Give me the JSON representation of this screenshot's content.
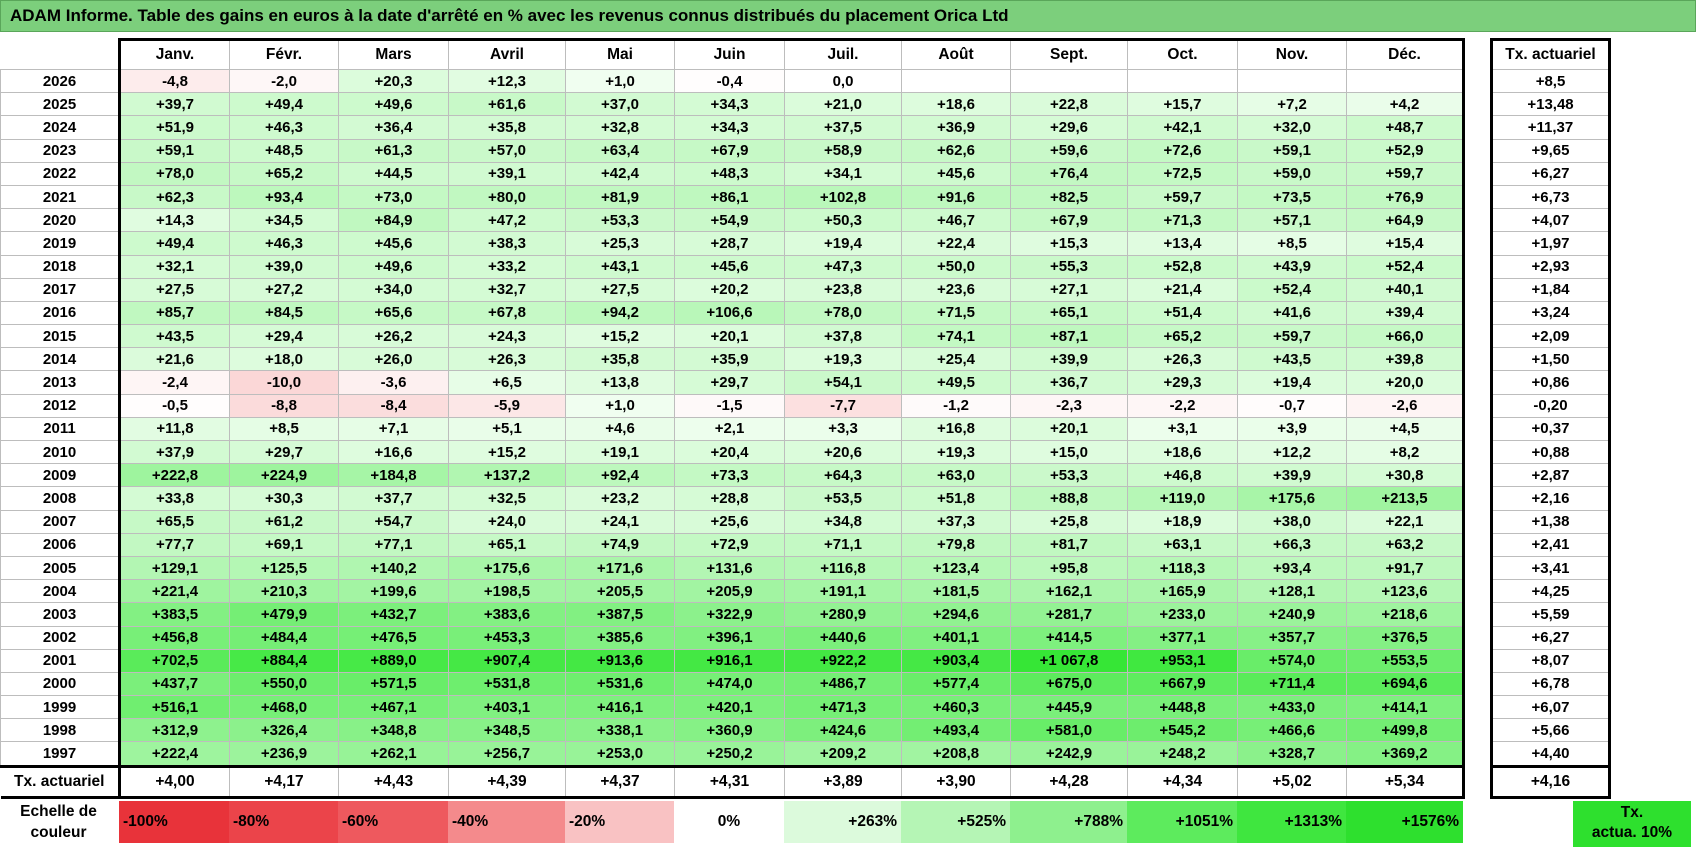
{
  "title": "ADAM Informe. Table des gains en euros à la date d'arrêté en % avec les revenus connus distribués du placement Orica Ltd",
  "months": [
    "Janv.",
    "Févr.",
    "Mars",
    "Avril",
    "Mai",
    "Juin",
    "Juil.",
    "Août",
    "Sept.",
    "Oct.",
    "Nov.",
    "Déc."
  ],
  "actuarial_header": "Tx. actuariel",
  "rows": [
    {
      "year": "2026",
      "values": [
        "-4,8",
        "-2,0",
        "+20,3",
        "+12,3",
        "+1,0",
        "-0,4",
        "0,0",
        "",
        "",
        "",
        "",
        ""
      ],
      "act": "+8,5"
    },
    {
      "year": "2025",
      "values": [
        "+39,7",
        "+49,4",
        "+49,6",
        "+61,6",
        "+37,0",
        "+34,3",
        "+21,0",
        "+18,6",
        "+22,8",
        "+15,7",
        "+7,2",
        "+4,2"
      ],
      "act": "+13,48"
    },
    {
      "year": "2024",
      "values": [
        "+51,9",
        "+46,3",
        "+36,4",
        "+35,8",
        "+32,8",
        "+34,3",
        "+37,5",
        "+36,9",
        "+29,6",
        "+42,1",
        "+32,0",
        "+48,7"
      ],
      "act": "+11,37"
    },
    {
      "year": "2023",
      "values": [
        "+59,1",
        "+48,5",
        "+61,3",
        "+57,0",
        "+63,4",
        "+67,9",
        "+58,9",
        "+62,6",
        "+59,6",
        "+72,6",
        "+59,1",
        "+52,9"
      ],
      "act": "+9,65"
    },
    {
      "year": "2022",
      "values": [
        "+78,0",
        "+65,2",
        "+44,5",
        "+39,1",
        "+42,4",
        "+48,3",
        "+34,1",
        "+45,6",
        "+76,4",
        "+72,5",
        "+59,0",
        "+59,7"
      ],
      "act": "+6,27"
    },
    {
      "year": "2021",
      "values": [
        "+62,3",
        "+93,4",
        "+73,0",
        "+80,0",
        "+81,9",
        "+86,1",
        "+102,8",
        "+91,6",
        "+82,5",
        "+59,7",
        "+73,5",
        "+76,9"
      ],
      "act": "+6,73"
    },
    {
      "year": "2020",
      "values": [
        "+14,3",
        "+34,5",
        "+84,9",
        "+47,2",
        "+53,3",
        "+54,9",
        "+50,3",
        "+46,7",
        "+67,9",
        "+71,3",
        "+57,1",
        "+64,9"
      ],
      "act": "+4,07"
    },
    {
      "year": "2019",
      "values": [
        "+49,4",
        "+46,3",
        "+45,6",
        "+38,3",
        "+25,3",
        "+28,7",
        "+19,4",
        "+22,4",
        "+15,3",
        "+13,4",
        "+8,5",
        "+15,4"
      ],
      "act": "+1,97"
    },
    {
      "year": "2018",
      "values": [
        "+32,1",
        "+39,0",
        "+49,6",
        "+33,2",
        "+43,1",
        "+45,6",
        "+47,3",
        "+50,0",
        "+55,3",
        "+52,8",
        "+43,9",
        "+52,4"
      ],
      "act": "+2,93"
    },
    {
      "year": "2017",
      "values": [
        "+27,5",
        "+27,2",
        "+34,0",
        "+32,7",
        "+27,5",
        "+20,2",
        "+23,8",
        "+23,6",
        "+27,1",
        "+21,4",
        "+52,4",
        "+40,1"
      ],
      "act": "+1,84"
    },
    {
      "year": "2016",
      "values": [
        "+85,7",
        "+84,5",
        "+65,6",
        "+67,8",
        "+94,2",
        "+106,6",
        "+78,0",
        "+71,5",
        "+65,1",
        "+51,4",
        "+41,6",
        "+39,4"
      ],
      "act": "+3,24"
    },
    {
      "year": "2015",
      "values": [
        "+43,5",
        "+29,4",
        "+26,2",
        "+24,3",
        "+15,2",
        "+20,1",
        "+37,8",
        "+74,1",
        "+87,1",
        "+65,2",
        "+59,7",
        "+66,0"
      ],
      "act": "+2,09"
    },
    {
      "year": "2014",
      "values": [
        "+21,6",
        "+18,0",
        "+26,0",
        "+26,3",
        "+35,8",
        "+35,9",
        "+19,3",
        "+25,4",
        "+39,9",
        "+26,3",
        "+43,5",
        "+39,8"
      ],
      "act": "+1,50"
    },
    {
      "year": "2013",
      "values": [
        "-2,4",
        "-10,0",
        "-3,6",
        "+6,5",
        "+13,8",
        "+29,7",
        "+54,1",
        "+49,5",
        "+36,7",
        "+29,3",
        "+19,4",
        "+20,0"
      ],
      "act": "+0,86"
    },
    {
      "year": "2012",
      "values": [
        "-0,5",
        "-8,8",
        "-8,4",
        "-5,9",
        "+1,0",
        "-1,5",
        "-7,7",
        "-1,2",
        "-2,3",
        "-2,2",
        "-0,7",
        "-2,6"
      ],
      "act": "-0,20"
    },
    {
      "year": "2011",
      "values": [
        "+11,8",
        "+8,5",
        "+7,1",
        "+5,1",
        "+4,6",
        "+2,1",
        "+3,3",
        "+16,8",
        "+20,1",
        "+3,1",
        "+3,9",
        "+4,5"
      ],
      "act": "+0,37"
    },
    {
      "year": "2010",
      "values": [
        "+37,9",
        "+29,7",
        "+16,6",
        "+15,2",
        "+19,1",
        "+20,4",
        "+20,6",
        "+19,3",
        "+15,0",
        "+18,6",
        "+12,2",
        "+8,2"
      ],
      "act": "+0,88"
    },
    {
      "year": "2009",
      "values": [
        "+222,8",
        "+224,9",
        "+184,8",
        "+137,2",
        "+92,4",
        "+73,3",
        "+64,3",
        "+63,0",
        "+53,3",
        "+46,8",
        "+39,9",
        "+30,8"
      ],
      "act": "+2,87"
    },
    {
      "year": "2008",
      "values": [
        "+33,8",
        "+30,3",
        "+37,7",
        "+32,5",
        "+23,2",
        "+28,8",
        "+53,5",
        "+51,8",
        "+88,8",
        "+119,0",
        "+175,6",
        "+213,5"
      ],
      "act": "+2,16"
    },
    {
      "year": "2007",
      "values": [
        "+65,5",
        "+61,2",
        "+54,7",
        "+24,0",
        "+24,1",
        "+25,6",
        "+34,8",
        "+37,3",
        "+25,8",
        "+18,9",
        "+38,0",
        "+22,1"
      ],
      "act": "+1,38"
    },
    {
      "year": "2006",
      "values": [
        "+77,7",
        "+69,1",
        "+77,1",
        "+65,1",
        "+74,9",
        "+72,9",
        "+71,1",
        "+79,8",
        "+81,7",
        "+63,1",
        "+66,3",
        "+63,2"
      ],
      "act": "+2,41"
    },
    {
      "year": "2005",
      "values": [
        "+129,1",
        "+125,5",
        "+140,2",
        "+175,6",
        "+171,6",
        "+131,6",
        "+116,8",
        "+123,4",
        "+95,8",
        "+118,3",
        "+93,4",
        "+91,7"
      ],
      "act": "+3,41"
    },
    {
      "year": "2004",
      "values": [
        "+221,4",
        "+210,3",
        "+199,6",
        "+198,5",
        "+205,5",
        "+205,9",
        "+191,1",
        "+181,5",
        "+162,1",
        "+165,9",
        "+128,1",
        "+123,6"
      ],
      "act": "+4,25"
    },
    {
      "year": "2003",
      "values": [
        "+383,5",
        "+479,9",
        "+432,7",
        "+383,6",
        "+387,5",
        "+322,9",
        "+280,9",
        "+294,6",
        "+281,7",
        "+233,0",
        "+240,9",
        "+218,6"
      ],
      "act": "+5,59"
    },
    {
      "year": "2002",
      "values": [
        "+456,8",
        "+484,4",
        "+476,5",
        "+453,3",
        "+385,6",
        "+396,1",
        "+440,6",
        "+401,1",
        "+414,5",
        "+377,1",
        "+357,7",
        "+376,5"
      ],
      "act": "+6,27"
    },
    {
      "year": "2001",
      "values": [
        "+702,5",
        "+884,4",
        "+889,0",
        "+907,4",
        "+913,6",
        "+916,1",
        "+922,2",
        "+903,4",
        "+1 067,8",
        "+953,1",
        "+574,0",
        "+553,5"
      ],
      "act": "+8,07"
    },
    {
      "year": "2000",
      "values": [
        "+437,7",
        "+550,0",
        "+571,5",
        "+531,8",
        "+531,6",
        "+474,0",
        "+486,7",
        "+577,4",
        "+675,0",
        "+667,9",
        "+711,4",
        "+694,6"
      ],
      "act": "+6,78"
    },
    {
      "year": "1999",
      "values": [
        "+516,1",
        "+468,0",
        "+467,1",
        "+403,1",
        "+416,1",
        "+420,1",
        "+471,3",
        "+460,3",
        "+445,9",
        "+448,8",
        "+433,0",
        "+414,1"
      ],
      "act": "+6,07"
    },
    {
      "year": "1998",
      "values": [
        "+312,9",
        "+326,4",
        "+348,8",
        "+348,5",
        "+338,1",
        "+360,9",
        "+424,6",
        "+493,4",
        "+581,0",
        "+545,2",
        "+466,6",
        "+499,8"
      ],
      "act": "+5,66"
    },
    {
      "year": "1997",
      "values": [
        "+222,4",
        "+236,9",
        "+262,1",
        "+256,7",
        "+253,0",
        "+250,2",
        "+209,2",
        "+208,8",
        "+242,9",
        "+248,2",
        "+328,7",
        "+369,2"
      ],
      "act": "+4,40"
    }
  ],
  "footer": {
    "label": "Tx. actuariel",
    "values": [
      "+4,00",
      "+4,17",
      "+4,43",
      "+4,39",
      "+4,37",
      "+4,31",
      "+3,89",
      "+3,90",
      "+4,28",
      "+4,34",
      "+5,02",
      "+5,34"
    ],
    "act": "+4,16"
  },
  "legend": {
    "label_line1": "Echelle de",
    "label_line2": "couleur",
    "items": [
      {
        "text": "-100%",
        "color": "#e8333a"
      },
      {
        "text": "-80%",
        "color": "#eb444a"
      },
      {
        "text": "-60%",
        "color": "#ee595e"
      },
      {
        "text": "-40%",
        "color": "#f48a8c"
      },
      {
        "text": "-20%",
        "color": "#f9c2c3"
      },
      {
        "text": "0%",
        "color": "#ffffff"
      },
      {
        "text": "+263%",
        "color": "#dcfadc"
      },
      {
        "text": "+525%",
        "color": "#b5f5b5"
      },
      {
        "text": "+788%",
        "color": "#8ef08e"
      },
      {
        "text": "+1051%",
        "color": "#5deb5d"
      },
      {
        "text": "+1313%",
        "color": "#3fe63f"
      },
      {
        "text": "+1576%",
        "color": "#2ee02e"
      }
    ],
    "act_line1": "Tx.",
    "act_line2": "actua. 10%"
  }
}
